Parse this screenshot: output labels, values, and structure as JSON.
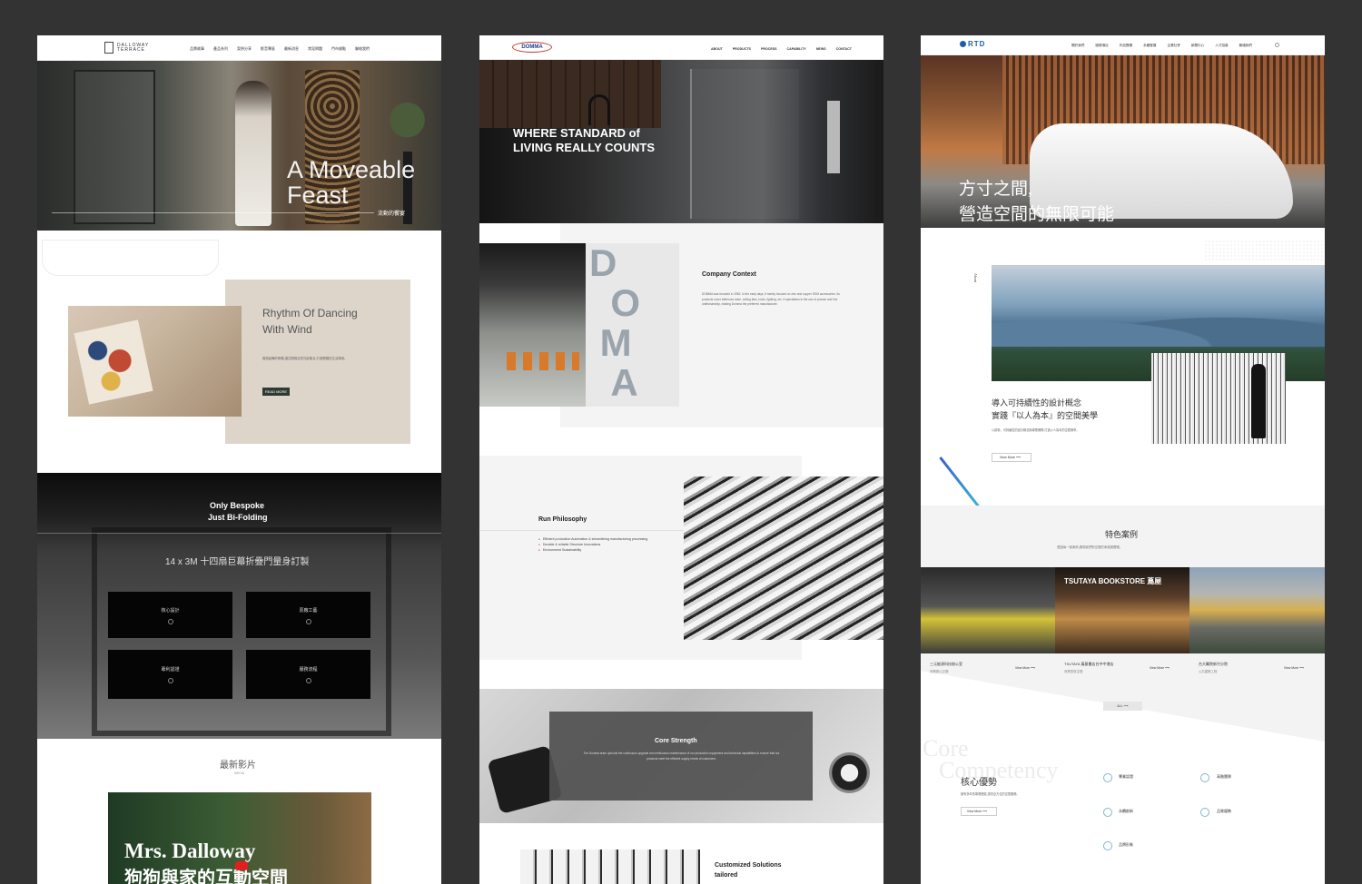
{
  "panel1": {
    "logo": "DALLOWAY TERRACE",
    "nav": [
      "品牌故事",
      "產品系列",
      "案例分享",
      "影音專區",
      "最新消息",
      "常見問題",
      "門市據點",
      "聯絡我們"
    ],
    "hero_title_1": "A Moveable",
    "hero_title_2": "Feast",
    "hero_sub": "流動的饗宴",
    "rhythm_title_1": "Rhythm Of Dancing",
    "rhythm_title_2": "With Wind",
    "rhythm_body": "隨風起舞的節奏,讓空間與自然光影融合,打造開闊的生活場域。",
    "read_more": "READ MORE",
    "bespoke_1": "Only Bespoke",
    "bespoke_2": "Just Bi-Folding",
    "bespoke_sub": "14 x 3M 十四扇巨幕折疊門量身訂製",
    "tiles": [
      "核心設計",
      "原廠工藝",
      "專利認證",
      "服務流程"
    ],
    "video_title": "最新影片",
    "video_sub": "MEDIA",
    "video_overlay_1": "Mrs. Dalloway",
    "video_overlay_2": "狗狗與家的互動空間"
  },
  "panel2": {
    "logo": "DOMMA",
    "nav": [
      "ABOUT",
      "PRODUCTS",
      "PROCESS",
      "CAPABILITY",
      "NEWS",
      "CONTACT"
    ],
    "hero_1": "WHERE STANDARD of",
    "hero_2": "LIVING REALLY COUNTS",
    "company_title": "Company Context",
    "company_body": "DOMMA was founded in 1982. In the early days, it mainly focused on zinc and copper OEM accessories. Its products cover bathroom ware, ceiling fans, locks, lighting, etc. It specializes in the use of precise and fine craftsmanship, making Domma the preferred manufacturer.",
    "run_title": "Run Philosophy",
    "run_bullets": [
      "Efficient production Automation & streamlining manufacturing processing",
      "Durable & reliable Structure Innovations",
      "Environment Sustainability"
    ],
    "core_title": "Core Strength",
    "core_body": "The Domma team upholds the continuous upgrade and meticulous maintenance of our production equipment and technical capabilities to ensure that our products meet the efficient supply needs of customers.",
    "custom_1": "Customized Solutions",
    "custom_2": "tailored"
  },
  "panel3": {
    "logo": "RTD",
    "nav": [
      "關於我們",
      "服務項目",
      "作品實績",
      "永續發展",
      "企業社會",
      "新聞中心",
      "人才招募",
      "聯絡我們"
    ],
    "hero_1": "方寸之間,",
    "hero_2": "營造空間的無限可能",
    "about_label": "About",
    "about_1": "導入可持續性的設計概念",
    "about_2": "實踐『以人為本』的空間美學",
    "about_body": "以創新、可持續性的設計概念與專業團隊,打造以人為本的空間美學。",
    "view_more": "View More",
    "cases_title": "特色案例",
    "cases_sub": "透過每一個案例,展現我們對空間的承諾與實踐。",
    "cases": [
      {
        "name": "三元能源科技辦公室",
        "tag": "商業辦公空間"
      },
      {
        "name": "TSUTAYA 蔦屋書店台中中港店",
        "tag": "商業零售空間"
      },
      {
        "name": "台大醫院新竹分院",
        "tag": "公共建築工程"
      }
    ],
    "bookstore_sign": "TSUTAYA BOOKSTORE 蔦屋",
    "all": "ALL",
    "comp_bg_1": "Core",
    "comp_bg_2": "Competency",
    "comp_title": "核心優勢",
    "comp_body": "擁有多年的專業經驗,提供全方位的空間服務。",
    "comp_items": [
      "專業認證",
      "高階團隊",
      "永續創新",
      "品質優勢",
      "品牌形象"
    ]
  }
}
